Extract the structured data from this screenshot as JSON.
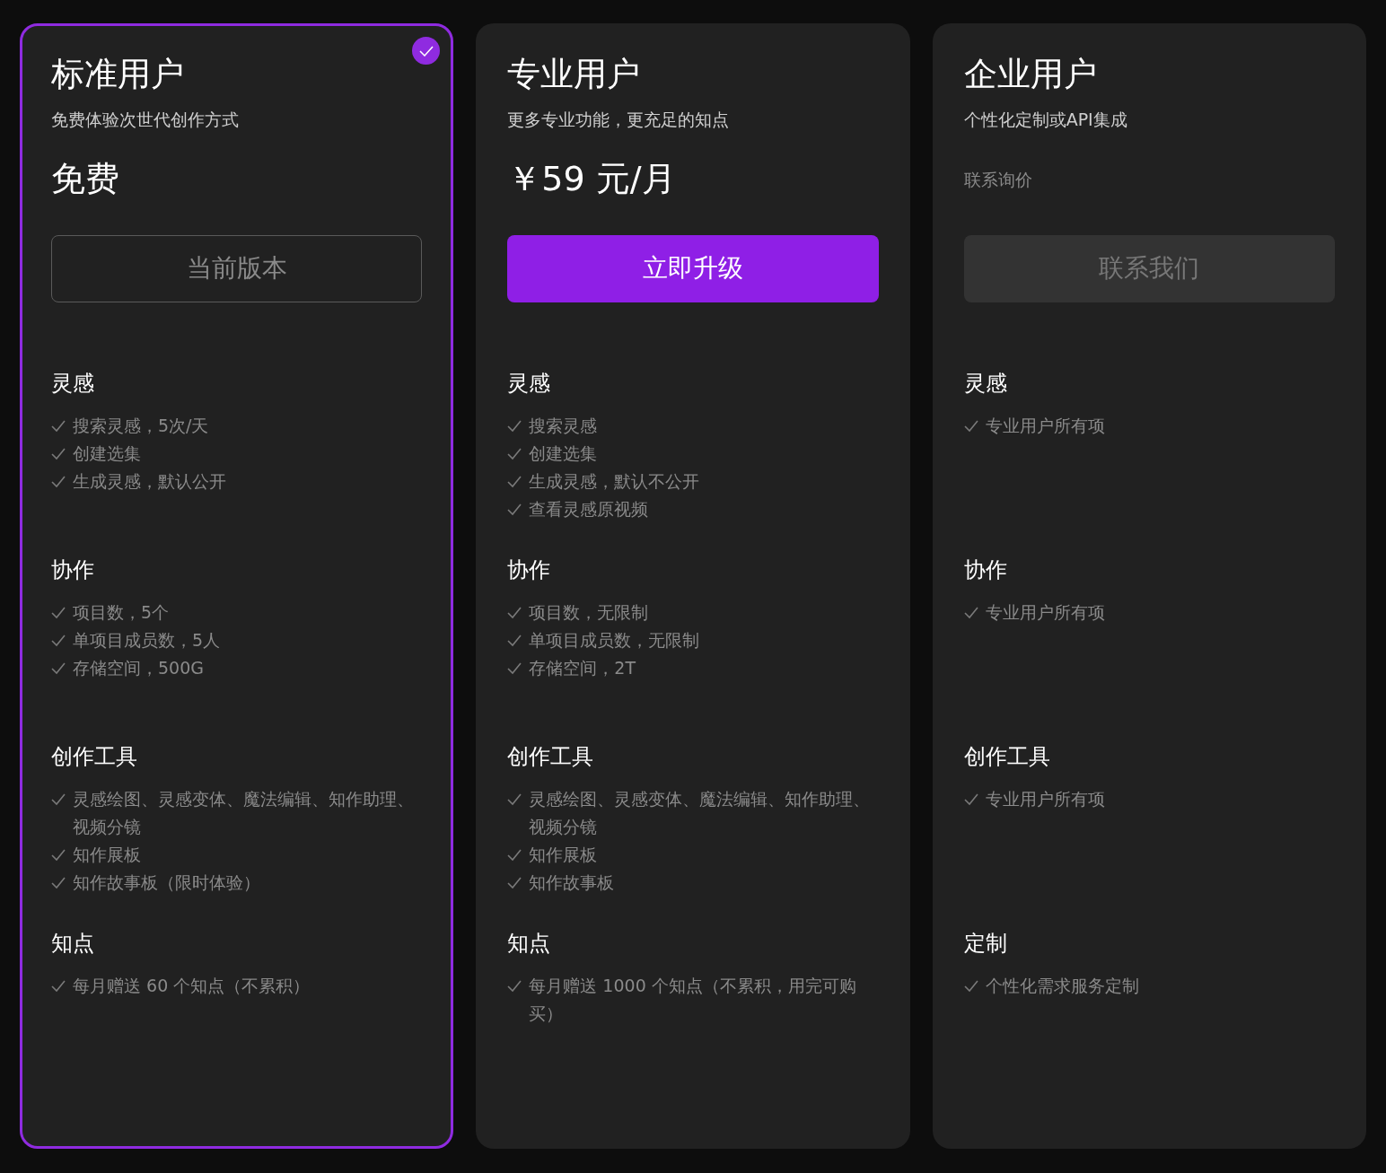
{
  "plans": [
    {
      "title": "标准用户",
      "subtitle": "免费体验次世代创作方式",
      "selected": true,
      "price": {
        "kind": "amount",
        "text": "免费"
      },
      "button": {
        "kind": "outline",
        "label": "当前版本"
      },
      "sections": [
        {
          "heading": "灵感",
          "items": [
            "搜索灵感，5次/天",
            "创建选集",
            "生成灵感，默认公开"
          ]
        },
        {
          "heading": "协作",
          "items": [
            "项目数，5个",
            "单项目成员数，5人",
            "存储空间，500G"
          ]
        },
        {
          "heading": "创作工具",
          "items": [
            "灵感绘图、灵感变体、魔法编辑、知作助理、视频分镜",
            "知作展板",
            "知作故事板（限时体验）"
          ]
        },
        {
          "heading": "知点",
          "items": [
            "每月赠送 60 个知点（不累积）"
          ]
        }
      ]
    },
    {
      "title": "专业用户",
      "subtitle": "更多专业功能，更充足的知点",
      "selected": false,
      "price": {
        "kind": "amount",
        "text": "￥59 元/月"
      },
      "button": {
        "kind": "primary",
        "label": "立即升级"
      },
      "sections": [
        {
          "heading": "灵感",
          "items": [
            "搜索灵感",
            "创建选集",
            "生成灵感，默认不公开",
            "查看灵感原视频"
          ]
        },
        {
          "heading": "协作",
          "items": [
            "项目数，无限制",
            "单项目成员数，无限制",
            "存储空间，2T"
          ]
        },
        {
          "heading": "创作工具",
          "items": [
            "灵感绘图、灵感变体、魔法编辑、知作助理、视频分镜",
            "知作展板",
            "知作故事板"
          ]
        },
        {
          "heading": "知点",
          "items": [
            "每月赠送 1000 个知点（不累积，用完可购买）"
          ]
        }
      ]
    },
    {
      "title": "企业用户",
      "subtitle": "个性化定制或API集成",
      "selected": false,
      "price": {
        "kind": "note",
        "text": "联系询价"
      },
      "button": {
        "kind": "muted",
        "label": "联系我们"
      },
      "sections": [
        {
          "heading": "灵感",
          "items": [
            "专业用户所有项"
          ]
        },
        {
          "heading": "协作",
          "items": [
            "专业用户所有项"
          ]
        },
        {
          "heading": "创作工具",
          "items": [
            "专业用户所有项"
          ]
        },
        {
          "heading": "定制",
          "items": [
            "个性化需求服务定制"
          ]
        }
      ]
    }
  ]
}
